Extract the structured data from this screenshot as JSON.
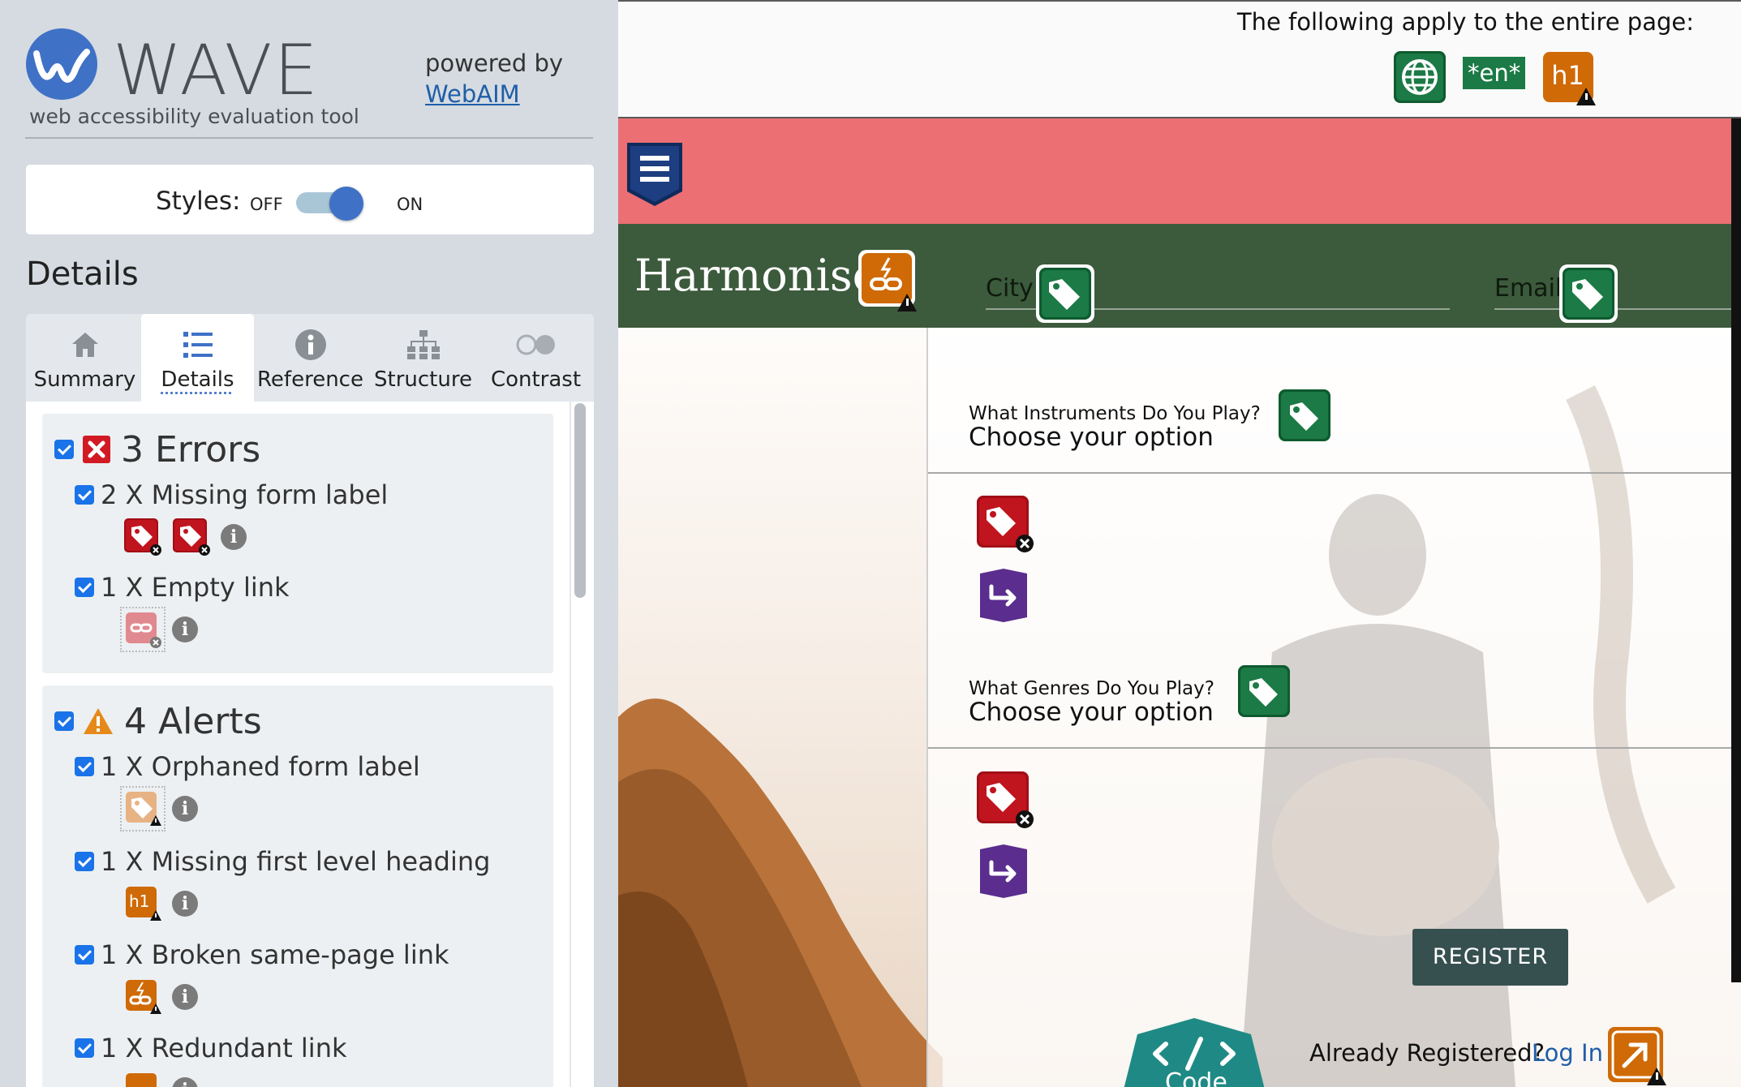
{
  "sidebar": {
    "brand": {
      "name": "WAVE",
      "tagline": "web accessibility evaluation tool",
      "powered_by": "powered by",
      "webaim_link": "WebAIM"
    },
    "styles": {
      "label": "Styles:",
      "off": "OFF",
      "on": "ON",
      "state": "on"
    },
    "details_heading": "Details",
    "tabs": [
      {
        "label": "Summary",
        "icon": "home-icon"
      },
      {
        "label": "Details",
        "icon": "list-icon",
        "active": true
      },
      {
        "label": "Reference",
        "icon": "info-icon"
      },
      {
        "label": "Structure",
        "icon": "hierarchy-icon"
      },
      {
        "label": "Contrast",
        "icon": "contrast-icon"
      }
    ],
    "errors": {
      "title": "3 Errors",
      "items": [
        {
          "label": "2 X Missing form label",
          "icons": [
            "missing-label-error-icon",
            "missing-label-error-icon"
          ]
        },
        {
          "label": "1 X Empty link",
          "icons": [
            "empty-link-error-icon"
          ]
        }
      ]
    },
    "alerts": {
      "title": "4 Alerts",
      "items": [
        {
          "label": "1 X Orphaned form label",
          "icons": [
            "orphaned-label-alert-icon"
          ]
        },
        {
          "label": "1 X Missing first level heading",
          "icons": [
            "h1-alert-icon"
          ],
          "icon_text": "h1"
        },
        {
          "label": "1 X Broken same-page link",
          "icons": [
            "broken-link-alert-icon"
          ]
        },
        {
          "label": "1 X Redundant link",
          "icons": [
            "redundant-link-alert-icon"
          ]
        }
      ]
    }
  },
  "main": {
    "apply_text": "The following apply to the entire page:",
    "page_icons": {
      "lang": "*en*",
      "heading": "h1"
    },
    "site_title": "Harmonise",
    "header_fields": [
      {
        "label": "City"
      },
      {
        "label": "Email"
      }
    ],
    "form": {
      "q1_small": "What Instruments Do You Play?",
      "q1_big": "Choose your option",
      "q2_small": "What Genres Do You Play?",
      "q2_big": "Choose your option",
      "register": "REGISTER",
      "already": "Already Registered?",
      "login": "Log In",
      "code_label": "Code"
    }
  },
  "colors": {
    "wave_blue": "#3f71c6",
    "error_red": "#c0141e",
    "alert_orange": "#cf6a06",
    "feature_green": "#1b7a45",
    "structure_navy": "#1d3e80",
    "aria_purple": "#5b2d8e",
    "pink_band": "#eb6f73",
    "header_green": "#3c5a3c",
    "register_bg": "#36504f"
  }
}
